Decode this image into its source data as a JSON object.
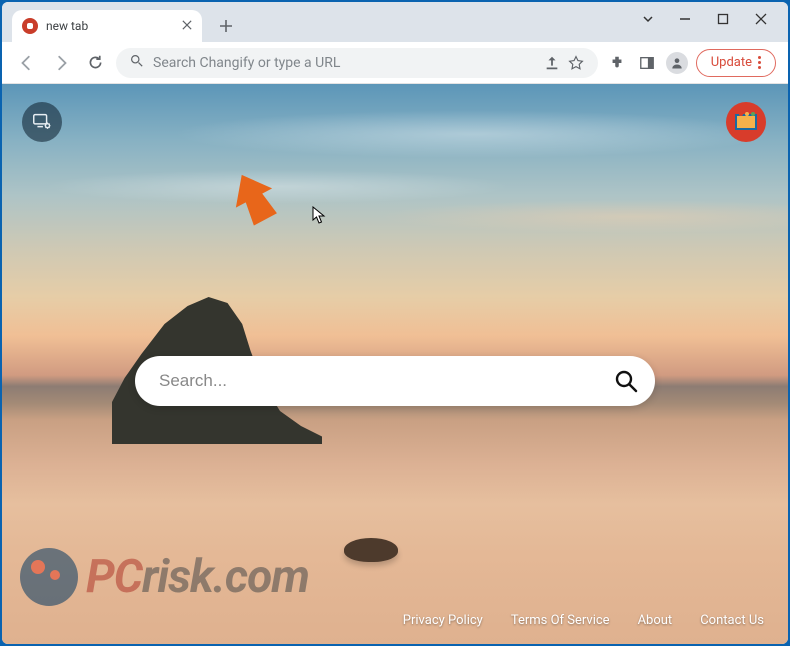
{
  "tab": {
    "title": "new tab"
  },
  "omnibox": {
    "placeholder": "Search Changify or type a URL"
  },
  "update": {
    "label": "Update"
  },
  "search": {
    "placeholder": "Search..."
  },
  "footer": {
    "privacy": "Privacy Policy",
    "terms": "Terms Of Service",
    "about": "About",
    "contact": "Contact Us"
  },
  "watermark": {
    "prefix": "PC",
    "suffix": "risk.com"
  }
}
